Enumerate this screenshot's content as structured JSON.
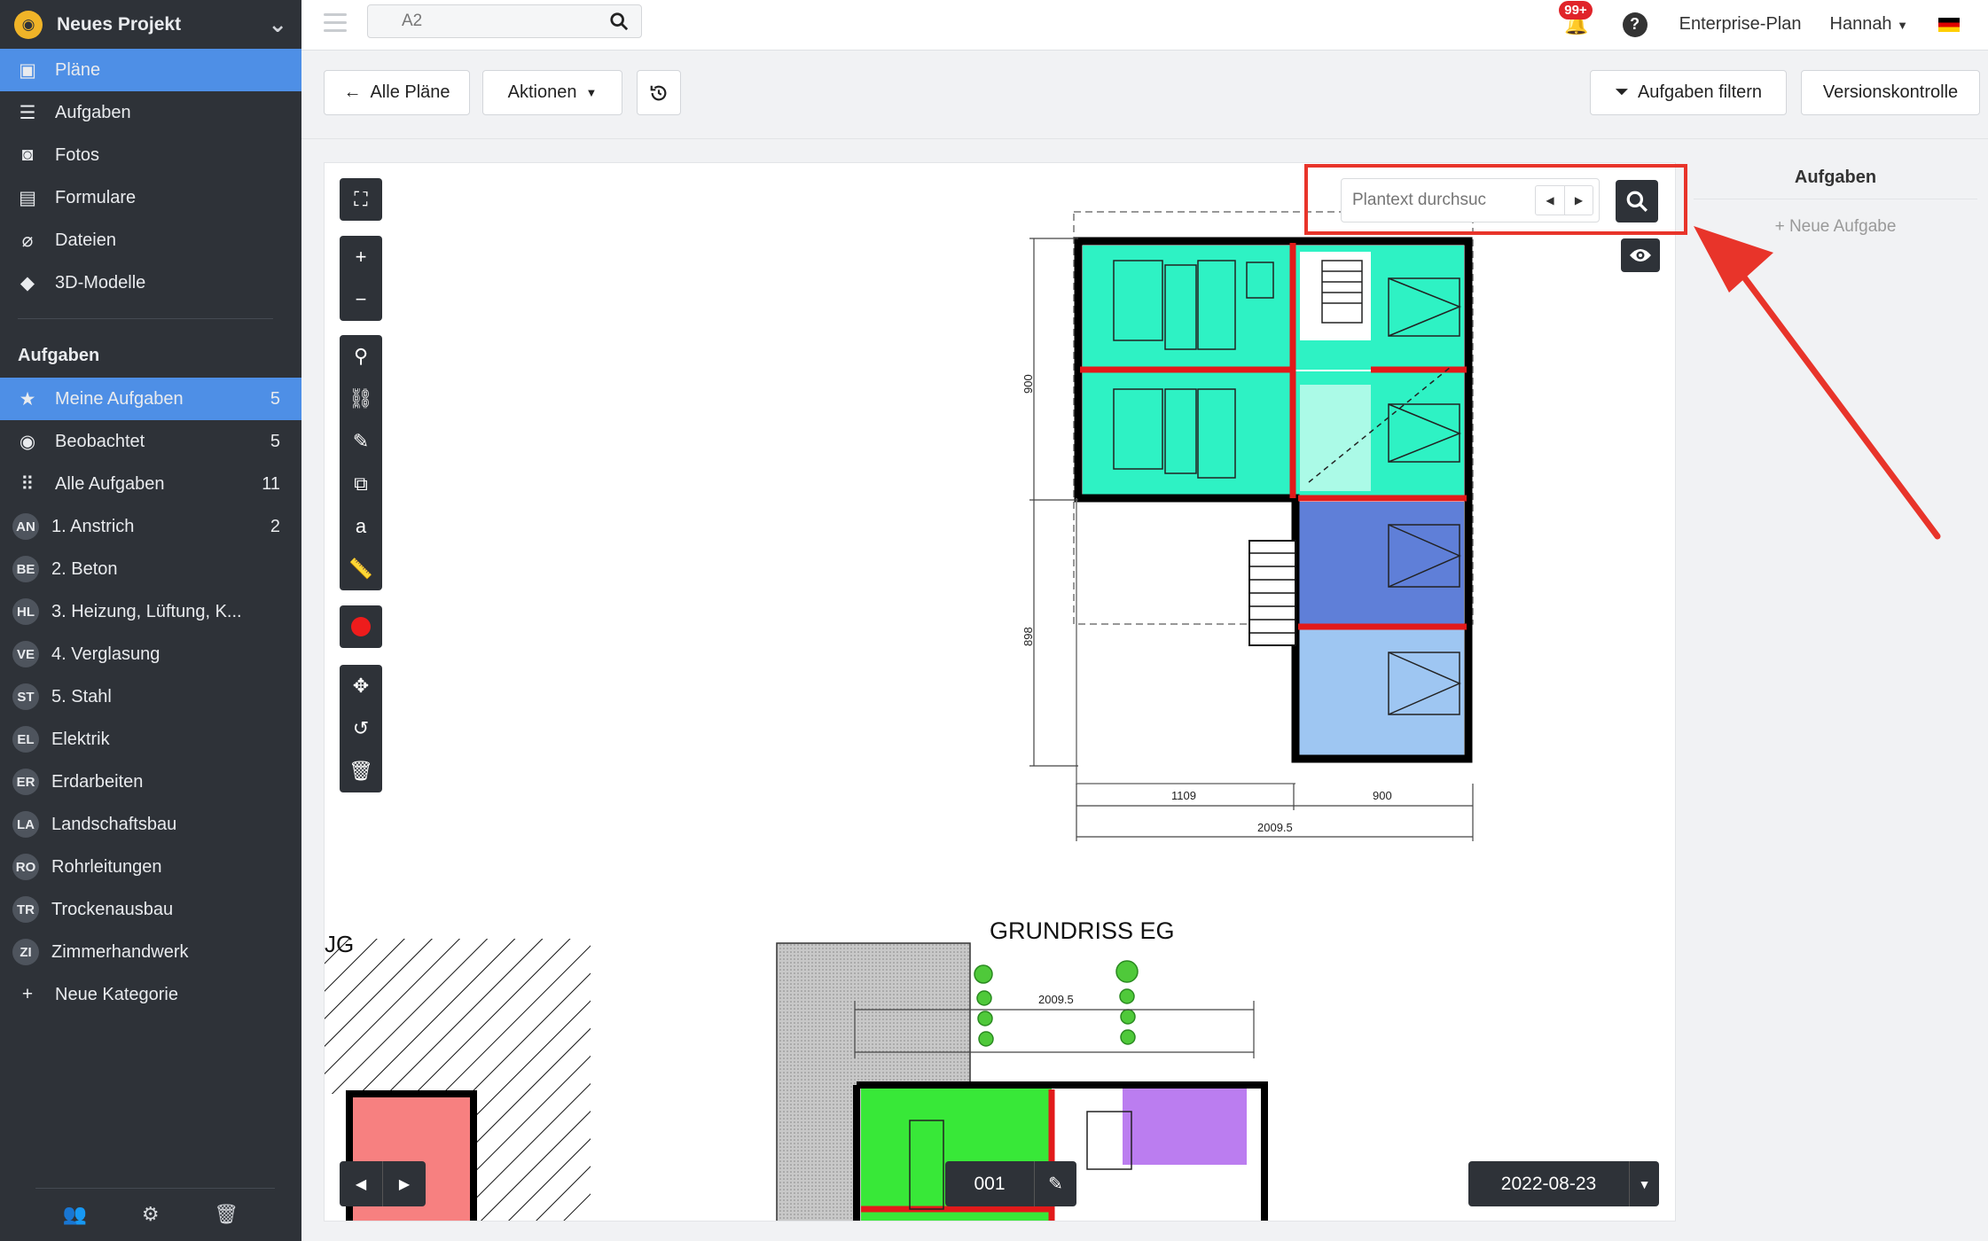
{
  "sidebar": {
    "project_title": "Neues Projekt",
    "nav": [
      {
        "label": "Pläne",
        "icon": "plans-icon",
        "active": true
      },
      {
        "label": "Aufgaben",
        "icon": "list-icon"
      },
      {
        "label": "Fotos",
        "icon": "camera-icon"
      },
      {
        "label": "Formulare",
        "icon": "clipboard-icon"
      },
      {
        "label": "Dateien",
        "icon": "paperclip-icon"
      },
      {
        "label": "3D-Modelle",
        "icon": "cube-icon"
      }
    ],
    "tasks_heading": "Aufgaben",
    "task_filters": [
      {
        "label": "Meine Aufgaben",
        "count": "5",
        "icon": "star-icon",
        "active": true
      },
      {
        "label": "Beobachtet",
        "count": "5",
        "icon": "eye-icon"
      },
      {
        "label": "Alle Aufgaben",
        "count": "11",
        "icon": "grid-icon"
      }
    ],
    "categories": [
      {
        "abbr": "AN",
        "label": "1. Anstrich",
        "count": "2"
      },
      {
        "abbr": "BE",
        "label": "2. Beton",
        "count": ""
      },
      {
        "abbr": "HL",
        "label": "3. Heizung, Lüftung, K...",
        "count": ""
      },
      {
        "abbr": "VE",
        "label": "4. Verglasung",
        "count": ""
      },
      {
        "abbr": "ST",
        "label": "5. Stahl",
        "count": ""
      },
      {
        "abbr": "EL",
        "label": "Elektrik",
        "count": ""
      },
      {
        "abbr": "ER",
        "label": "Erdarbeiten",
        "count": ""
      },
      {
        "abbr": "LA",
        "label": "Landschaftsbau",
        "count": ""
      },
      {
        "abbr": "RO",
        "label": "Rohrleitungen",
        "count": ""
      },
      {
        "abbr": "TR",
        "label": "Trockenausbau",
        "count": ""
      },
      {
        "abbr": "ZI",
        "label": "Zimmerhandwerk",
        "count": ""
      }
    ],
    "new_category": "Neue Kategorie"
  },
  "topbar": {
    "search_value": "A2",
    "notifications": "99+",
    "plan_label": "Enterprise-Plan",
    "user_label": "Hannah"
  },
  "toolbar": {
    "all_plans": "Alle Pläne",
    "actions": "Aktionen",
    "filter_tasks": "Aufgaben filtern",
    "version_control": "Versionskontrolle"
  },
  "plan": {
    "search_placeholder": "Plantext durchsuc",
    "page_number": "001",
    "date": "2022-08-23",
    "dims": {
      "left_top": "900",
      "left_bottom": "898",
      "bottom_left": "1109",
      "bottom_right": "900",
      "bottom_total": "2009.5",
      "second_total": "2009.5"
    },
    "second_title": "GRUNDRISS EG",
    "partial_label": "JG"
  },
  "tasks_panel": {
    "title": "Aufgaben",
    "new_task": "+ Neue Aufgabe"
  },
  "colors": {
    "sidebar_bg": "#2e3238",
    "active_blue": "#4e8fe6",
    "highlight_red": "#e8342a",
    "room_teal": "#2ef2c4",
    "room_blue": "#5f7fd8",
    "room_lightblue": "#9ec6f2",
    "room_green": "#38e838",
    "room_purple": "#bb7df0",
    "room_salmon": "#f78080"
  }
}
